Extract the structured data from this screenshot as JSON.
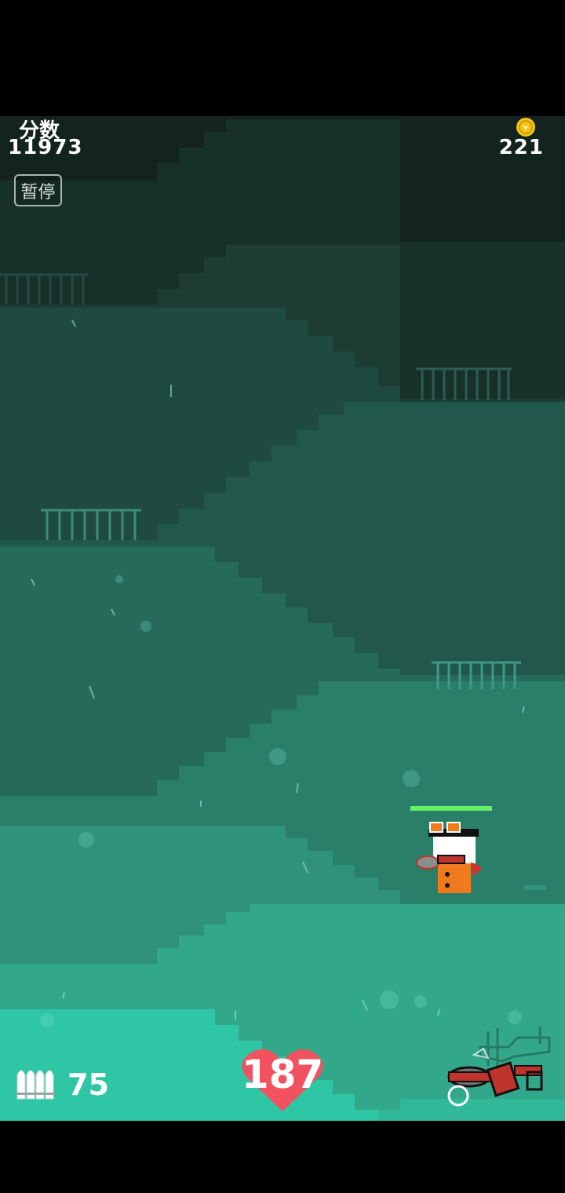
{
  "hud": {
    "score_label": "分数",
    "score_value": "11973",
    "coins": "221",
    "pause_label": "暂停",
    "ammo": "75",
    "health": "187"
  },
  "player": {
    "health_fraction": 1.0
  },
  "icons": {
    "coin": "coin-icon",
    "ammo": "bullets-icon",
    "health": "heart-icon",
    "weapon": "rocket-launcher-icon",
    "switch": "switch-weapon-icon"
  },
  "colors": {
    "accent_heart": "#f2525f",
    "coin": "#f5c518",
    "player_body": "#f07a1e",
    "health_bar": "#66ee66",
    "water": "#2fc6a6"
  }
}
